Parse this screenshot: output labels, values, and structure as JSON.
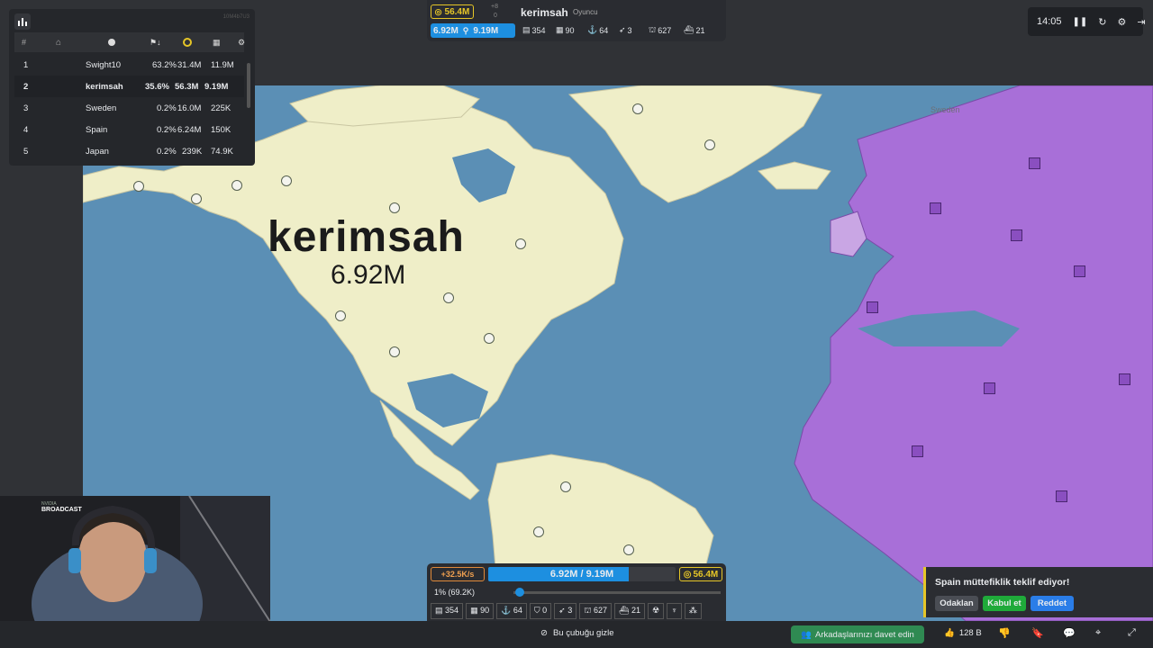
{
  "leaderboard": {
    "tiny_note": "10M4b7U3",
    "headers": [
      "#",
      "",
      "",
      "",
      "",
      "",
      ""
    ],
    "rows": [
      {
        "rank": "1",
        "name": "Swight10",
        "pct": "63.2%",
        "gold": "31.4M",
        "troops": "11.9M",
        "highlight": false
      },
      {
        "rank": "2",
        "name": "kerimsah",
        "pct": "35.6%",
        "gold": "56.3M",
        "troops": "9.19M",
        "highlight": true
      },
      {
        "rank": "3",
        "name": "Sweden",
        "pct": "0.2%",
        "gold": "16.0M",
        "troops": "225K",
        "highlight": false
      },
      {
        "rank": "4",
        "name": "Spain",
        "pct": "0.2%",
        "gold": "6.24M",
        "troops": "150K",
        "highlight": false
      },
      {
        "rank": "5",
        "name": "Japan",
        "pct": "0.2%",
        "gold": "239K",
        "troops": "74.9K",
        "highlight": false
      }
    ]
  },
  "topbar": {
    "gold": "56.4M",
    "plus_label": "+8",
    "zero_label": "0",
    "player_name": "kerimsah",
    "player_role": "Oyuncu",
    "troops_current": "6.92M",
    "troops_max": "9.19M",
    "stats": [
      {
        "icon": "city-icon",
        "value": "354"
      },
      {
        "icon": "factory-icon",
        "value": "90"
      },
      {
        "icon": "anchor-icon",
        "value": "64"
      },
      {
        "icon": "missile-icon",
        "value": "3"
      },
      {
        "icon": "defense-icon",
        "value": "627"
      },
      {
        "icon": "warship-icon",
        "value": "21"
      }
    ]
  },
  "top_right": {
    "time": "14:05"
  },
  "map": {
    "player_label": "kerimsah",
    "player_troops": "6.92M",
    "region_labels": [
      "Sweden"
    ]
  },
  "bottom_panel": {
    "income": "+32.5K/s",
    "troops_ratio": "6.92M / 9.19M",
    "troops_fill": 0.75,
    "gold": "56.4M",
    "attack_ratio": "1% (69.2K)",
    "slider_fraction": 0.01,
    "stats": [
      {
        "icon": "city-icon",
        "value": "354"
      },
      {
        "icon": "factory-icon",
        "value": "90"
      },
      {
        "icon": "anchor-icon",
        "value": "64"
      },
      {
        "icon": "shield-icon",
        "value": "0"
      },
      {
        "icon": "missile-icon",
        "value": "3"
      },
      {
        "icon": "defense-icon",
        "value": "627"
      },
      {
        "icon": "warship-icon",
        "value": "21"
      }
    ]
  },
  "toast": {
    "message": "Spain müttefiklik teklif ediyor!",
    "focus_label": "Odaklan",
    "accept_label": "Kabul et",
    "reject_label": "Reddet"
  },
  "bottom_bar": {
    "hide_bar_label": "Bu çubuğu gizle",
    "invite_label": "Arkadaşlarınızı davet edin",
    "likes": "128 B"
  },
  "webcam": {
    "brand_line1": "NVIDIA",
    "brand_line2": "BROADCAST"
  },
  "colors": {
    "ocean": "#5b8fb5",
    "land": "#efeec8",
    "player_territory": "#f2f0cc",
    "enemy_territory": "#a86fd8",
    "accent_blue": "#1d8fe0",
    "gold": "#e8b820"
  }
}
